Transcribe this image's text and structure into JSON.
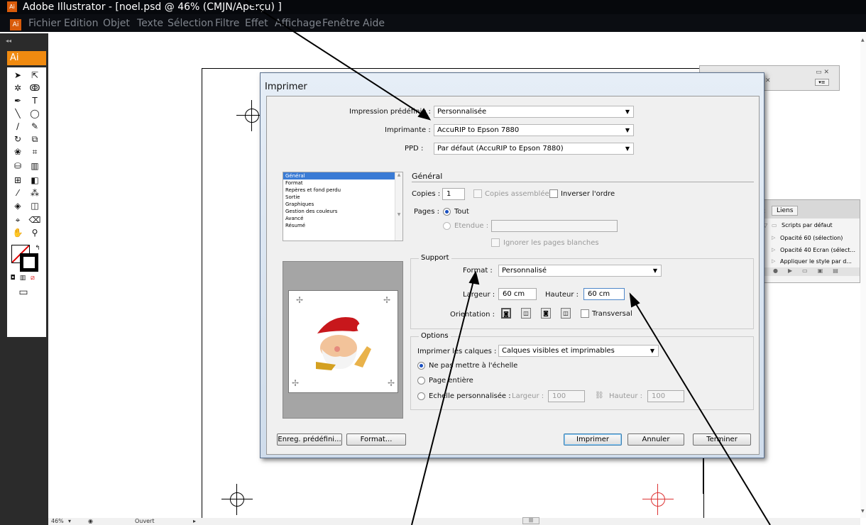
{
  "window": {
    "title": "Adobe Illustrator - [noel.psd @ 46% (CMJN/Aperçu) ]",
    "app_icon": "Ai"
  },
  "menubar": {
    "items": [
      "Fichier",
      "Edition",
      "Objet",
      "Texte",
      "Sélection",
      "Filtre",
      "Effet",
      "Affichage",
      "Fenêtre",
      "Aide"
    ]
  },
  "toolbox": {
    "logo": "Ai",
    "gripper": "◂◂"
  },
  "dialog": {
    "title": "Imprimer",
    "preset_label": "Impression prédéfinie :",
    "preset_value": "Personnalisée",
    "printer_label": "Imprimante :",
    "printer_value": "AccuRIP to Epson 7880",
    "ppd_label": "PPD :",
    "ppd_value": "Par défaut (AccuRIP to Epson 7880)",
    "categories": [
      "Général",
      "Format",
      "Repères et fond perdu",
      "Sortie",
      "Graphiques",
      "Gestion des couleurs",
      "Avancé",
      "Résumé"
    ],
    "section_title": "Général",
    "copies_label": "Copies :",
    "copies_value": "1",
    "collate_label": "Copies assemblées",
    "reverse_label": "Inverser l'ordre",
    "pages_label": "Pages :",
    "pages_all": "Tout",
    "pages_range": "Etendue :",
    "ignore_blank": "Ignorer les pages blanches",
    "support_title": "Support",
    "format_label": "Format :",
    "format_value": "Personnalisé",
    "width_label": "Largeur :",
    "width_value": "60 cm",
    "height_label": "Hauteur :",
    "height_value": "60 cm",
    "orientation_label": "Orientation :",
    "transverse_label": "Transversal",
    "options_title": "Options",
    "layers_label": "Imprimer les calques :",
    "layers_value": "Calques visibles et imprimables",
    "scale_none": "Ne pas mettre à l'échelle",
    "scale_fit": "Page entière",
    "scale_custom": "Echelle personnalisée :",
    "scale_width_label": "Largeur :",
    "scale_width_value": "100",
    "scale_height_label": "Hauteur :",
    "scale_height_value": "100",
    "btn_save_preset": "Enreg. prédéfini...",
    "btn_format": "Format...",
    "btn_print": "Imprimer",
    "btn_cancel": "Annuler",
    "btn_done": "Terminer"
  },
  "panel_actions": {
    "tab_liens": "Liens",
    "items": [
      "Scripts par défaut",
      "Opacité 60 (sélection)",
      "Opacité 40 Ecran (sélect...",
      "Appliquer le style par d..."
    ]
  },
  "statusbar": {
    "zoom": "46%",
    "status": "Ouvert"
  }
}
